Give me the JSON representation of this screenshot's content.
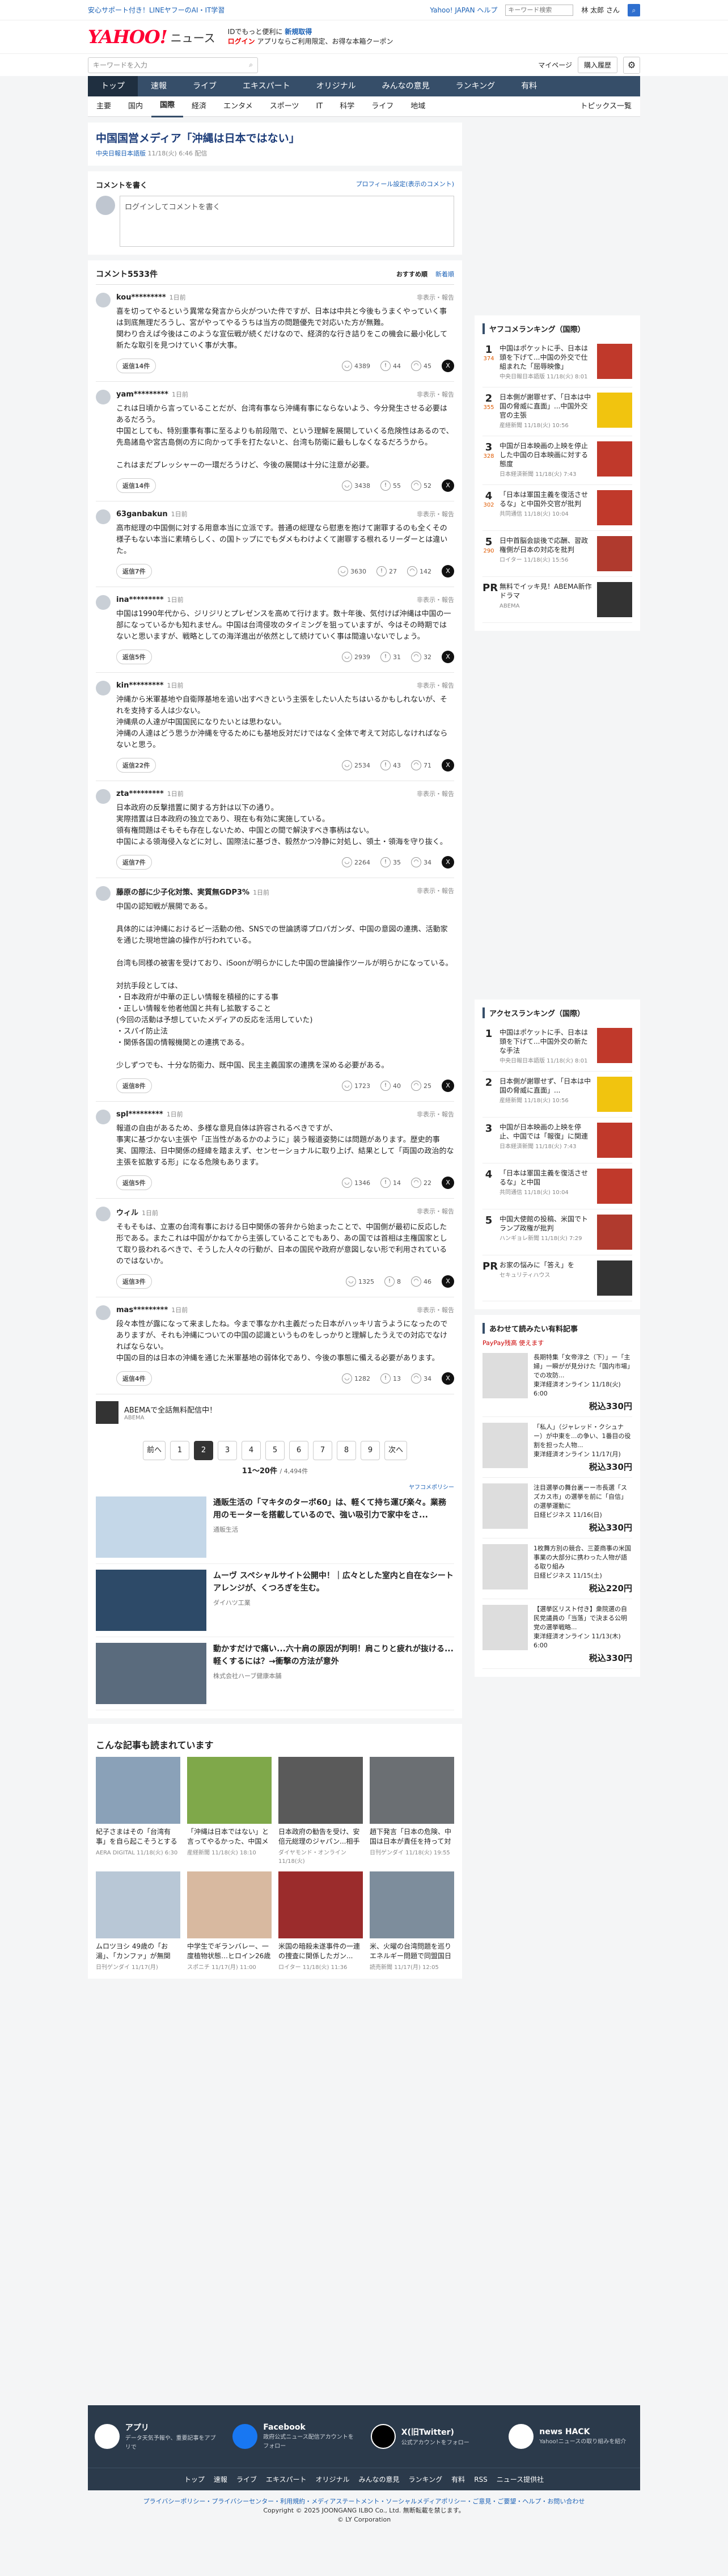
{
  "topbar": {
    "left": "安心サポート付き！LINEヤフーのAI・IT学習",
    "help": "Yahoo! JAPAN ヘルプ",
    "placeholder": "キーワード検索",
    "user": "林 太郎 さん"
  },
  "header": {
    "logo": "YAHOO!",
    "logo_sub": "JAPAN",
    "service": "ニュース",
    "promo1": "IDでもっと便利に",
    "promo1b": "新規取得",
    "promo2": "ログイン",
    "promo3": "アプリならご利用限定、お得な本箱クーポン"
  },
  "search": {
    "placeholder": "キーワードを入力",
    "mypage": "マイページ",
    "purchase": "購入履歴"
  },
  "gnav": [
    "トップ",
    "速報",
    "ライブ",
    "エキスパート",
    "オリジナル",
    "みんなの意見",
    "ランキング",
    "有料"
  ],
  "subnav": [
    "主要",
    "国内",
    "国際",
    "経済",
    "エンタメ",
    "スポーツ",
    "IT",
    "科学",
    "ライフ",
    "地域"
  ],
  "topics_list": "トピックス一覧",
  "article": {
    "title": "中国国営メディア「沖縄は日本ではない」",
    "source": "中央日報日本語版",
    "time": "11/18(火) 6:46",
    "sub": "配信"
  },
  "comment_form": {
    "title": "コメントを書く",
    "profile_link": "プロフィール設定(表示のコメント)",
    "placeholder": "ログインしてコメントを書く"
  },
  "comments_header": {
    "count": "コメント5533件",
    "sort_rec": "おすすめ順",
    "sort_new": "新着順"
  },
  "comments": [
    {
      "user": "kou*********",
      "time": "1日前",
      "report": "非表示・報告",
      "text": "喜を切ってやるという異常な発言から火がついた件ですが、日本は中共と今後もうまくやっていく事は到底無理だろうし、宮がやってやるうちは当方の問題優先で対応いた方が無難。\n関わり合えば今後はこのような宣伝戦が続くだけなので、経済的な行き詰りをこの機会に最小化して新たな取引を見つけていく事が大事。",
      "reply": "返信14件",
      "v1": "4389",
      "v2": "44",
      "v3": "45"
    },
    {
      "user": "yam*********",
      "time": "1日前",
      "report": "非表示・報告",
      "text": "これは日頃から言っていることだが、台湾有事なら沖縄有事にならないよう、今分発生させる必要はあるだろう。\n中国としても、特別重事有事に至るよりも前段階で、という理解を展開していくる危険性はあるので、先島諸島や宮古島側の方に向かって手を打たないと、台湾も防衛に最もしなくなるだろうから。\n\nこれはまだプレッシャーの一環だろうけど、今後の展開は十分に注意が必要。",
      "reply": "返信14件",
      "v1": "3438",
      "v2": "55",
      "v3": "52"
    },
    {
      "user": "63ganbakun",
      "time": "1日前",
      "report": "非表示・報告",
      "text": "高市総理の中国側に対する用意本当に立派です。普通の総理なら慰恵を抱けて謝罪するのも全くその様子もない本当に素晴らしく、の国トップにでもダメもわけよくて謝罪する根れるリーダーとは違いた。",
      "reply": "返信7件",
      "v1": "3630",
      "v2": "27",
      "v3": "142"
    },
    {
      "user": "ina*********",
      "time": "1日前",
      "report": "非表示・報告",
      "text": "中国は1990年代から、ジリジリとプレゼンスを高めて行けます。数十年後、気付けば沖縄は中国の一部になっているかも知れません。中国は台湾侵攻のタイミングを狙っていますが、今はその時期ではないと思いますが、戦略としての海洋進出が依然として続けていく事は間違いないでしょう。",
      "reply": "返信5件",
      "v1": "2939",
      "v2": "31",
      "v3": "32"
    },
    {
      "user": "kin*********",
      "time": "1日前",
      "report": "非表示・報告",
      "text": "沖縄から米軍基地や自衛隊基地を追い出すべきという主張をしたい人たちはいるかもしれないが、それを支持する人は少ない。\n沖縄県の人達が中国国民になりたいとは思わない。\n沖縄の人達はどう思うか沖縄を守るためにも基地反対だけではなく全体で考えて対応しなければならないと思う。",
      "reply": "返信22件",
      "v1": "2534",
      "v2": "43",
      "v3": "71"
    },
    {
      "user": "zta*********",
      "time": "1日前",
      "report": "非表示・報告",
      "text": "日本政府の反撃措置に関する方針は以下の通り。\n実際措置は日本政府の独立であり、現在も有効に実施している。\n領有権問題はそもそも存在しないため、中国との間で解決すべき事柄はない。\n中国による領海侵入などに対し、国際法に基づき、毅然かつ冷静に対処し、領土・領海を守り抜く。",
      "reply": "返信7件",
      "v1": "2264",
      "v2": "35",
      "v3": "34"
    },
    {
      "user": "藤原の部に少子化対策、実質無GDP3%",
      "time": "1日前",
      "report": "非表示・報告",
      "text": "中国の認知戦が展開である。\n\n具体的には沖縄におけるビー活動の他、SNSでの世論誘導プロパガンダ、中国の意図の連携、活動家を通じた現地世論の操作が行われている。\n\n台湾も同様の被害を受けており、iSoonが明らかにした中国の世論操作ツールが明らかになっている。\n\n対抗手段としては、\n・日本政府が中華の正しい情報を積極的にする事\n・正しい情報を他者他国と共有し拡散すること\n(今回の活動は予想していたメディアの反応を活用していた)\n・スパイ防止法\n・関係各国の情報機関との連携である。\n\n少しずつでも、十分な防衛力、既中国、民主主義国家の連携を深める必要がある。",
      "reply": "返信8件",
      "v1": "1723",
      "v2": "40",
      "v3": "25"
    },
    {
      "user": "spl*********",
      "time": "1日前",
      "report": "非表示・報告",
      "text": "報道の自由があるため、多様な意見自体は許容されるべきですが、\n事実に基づかない主張や「正当性があるかのように」装う報道姿勢には問題があります。歴史的事実、国際法、日中関係の経緯を踏まえず、センセーショナルに取り上げ、結果として「両国の政治的な主張を拡散する形」になる危険もあります。",
      "reply": "返信5件",
      "v1": "1346",
      "v2": "14",
      "v3": "22"
    },
    {
      "user": "ウィル",
      "time": "1日前",
      "report": "非表示・報告",
      "text": "そもそもは、立憲の台湾有事における日中関係の答弁から始まったことで、中国側が最初に反応した形である。またこれは中国がかねてから主張していることでもあり、あの国では首相は主権国家として取り扱われるべきで、そうした人々の行動が、日本の国民や政府が意図しない形で利用されているのではないか。",
      "reply": "返信3件",
      "v1": "1325",
      "v2": "8",
      "v3": "46"
    },
    {
      "user": "mas*********",
      "time": "1日前",
      "report": "非表示・報告",
      "text": "段々本性が露になって来ましたね。今まで事なかれ主義だった日本がハッキリ言うようになったのでありますが、それも沖縄についての中国の認識というものをしっかりと理解したうえでの対応でなければならない。\n中国の目的は日本の沖縄を通じた米軍基地の弱体化であり、今後の事態に備える必要があります。",
      "reply": "返信4件",
      "v1": "1282",
      "v2": "13",
      "v3": "34"
    }
  ],
  "ad_inline": {
    "text": "ABEMAで全話無料配信中！",
    "sub": "ABEMA"
  },
  "pager": {
    "prev": "前へ",
    "next": "次へ",
    "pages": [
      "1",
      "2",
      "3",
      "4",
      "5",
      "6",
      "7",
      "8",
      "9"
    ],
    "current": "2",
    "range": "11〜20件",
    "total": "/ 4,494件"
  },
  "yahoo_sponsor": "ヤフコメポリシー",
  "ads": [
    {
      "title": "通販生活の「マキタのターボ60」は、軽くて持ち運び楽々。業務用のモーターを搭載しているので、強い吸引力で家中をさ...",
      "src": "通販生活"
    },
    {
      "title": "ムーヴ スペシャルサイト公開中！｜広々とした室内と自在なシートアレンジが、くつろぎを生む。",
      "src": "ダイハツ工業"
    },
    {
      "title": "動かすだけで痛い...六十肩の原因が判明！肩こりと疲れが抜ける...軽くするには？→衝撃の方法が意外",
      "src": "株式会社ハーブ健康本舗"
    }
  ],
  "also_read": {
    "title": "こんな記事も読まれています",
    "items": [
      {
        "t": "紀子さまはその「台湾有事」を自ら起こそうとする高市首相",
        "s": "AERA DIGITAL 11/18(火) 6:30"
      },
      {
        "t": "「沖縄は日本ではない」と言ってやるかった、中国メディアの主張",
        "s": "産経新聞 11/18(火) 18:10"
      },
      {
        "t": "日本政府の勧告を受け、安倍元総理のジャパン...相手の実力を...",
        "s": "ダイヤモンド・オンライン 11/18(火)"
      },
      {
        "t": "趙下発言「日本の危険、中国は日本が責任を持って対処...",
        "s": "日刊ゲンダイ 11/18(火) 19:55"
      },
      {
        "t": "ムロツヨシ 49歳の「お湯」、「カンファ」が無関連...",
        "s": "日刊ゲンダイ 11/17(月)"
      },
      {
        "t": "中学生でギランバレー、一度植物状態…ヒロイン26歳の前向き...",
        "s": "スポニチ 11/17(月) 11:00"
      },
      {
        "t": "米国の暗殺未遂事件の一連の捜査に関係したガン...",
        "s": "ロイター 11/18(火) 11:36"
      },
      {
        "t": "米、火曜の台湾問題を巡りエネルギー問題で同盟国日本への働きかけ",
        "s": "読売新聞 11/17(月) 12:05"
      }
    ]
  },
  "ranking": {
    "title": "ヤフコメランキング（国際）",
    "items": [
      {
        "no": "1",
        "c": "374",
        "t": "中国はポケットに手、日本は頭を下げて...中国の外交で仕組まれた「屈辱映像」",
        "m": "中央日報日本語版 11/18(火) 8:01"
      },
      {
        "no": "2",
        "c": "355",
        "t": "日本側が謝罪せず、「日本は中国の脅威に直面」...中国外交官の主張",
        "m": "産経新聞 11/18(火) 10:56"
      },
      {
        "no": "3",
        "c": "328",
        "t": "中国が日本映画の上映を停止した中国の日本映画に対する態度",
        "m": "日本経済新聞 11/18(火) 7:43"
      },
      {
        "no": "4",
        "c": "302",
        "t": "「日本は軍国主義を復活させるな」と中国外交官が批判",
        "m": "共同通信 11/18(火) 10:04"
      },
      {
        "no": "5",
        "c": "290",
        "t": "日中首脳会談後で応酬、習政権側が日本の対応を批判",
        "m": "ロイター 11/18(火) 15:56"
      },
      {
        "no": "PR",
        "c": "",
        "t": "無料でイッキ見！ABEMA新作ドラマ",
        "m": "ABEMA"
      }
    ]
  },
  "access": {
    "title": "アクセスランキング（国際）",
    "items": [
      {
        "no": "1",
        "t": "中国はポケットに手、日本は頭を下げて...中国外交の新たな手法",
        "m": "中央日報日本語版 11/18(火) 8:01"
      },
      {
        "no": "2",
        "t": "日本側が謝罪せず、「日本は中国の脅威に直面」...",
        "m": "産経新聞 11/18(火) 10:56"
      },
      {
        "no": "3",
        "t": "中国が日本映画の上映を停止、中国では「報復」に関連",
        "m": "日本経済新聞 11/18(火) 7:43"
      },
      {
        "no": "4",
        "t": "「日本は軍国主義を復活させるな」と中国",
        "m": "共同通信 11/18(火) 10:04"
      },
      {
        "no": "5",
        "t": "中国大使館の投稿、米国でトランプ政権が批判",
        "m": "ハンギョレ新聞 11/18(火) 7:29"
      },
      {
        "no": "PR",
        "t": "お家の悩みに「答え」を",
        "m": "セキュリティハウス"
      }
    ]
  },
  "shopping": {
    "title": "あわせて読みたい有料記事",
    "sub": "PayPay残高 使えます",
    "items": [
      {
        "t": "長期特集「女帝淳之（下）」ー「主婦」一瞬がが見分けた「国内市場」での攻防...",
        "m": "東洋経済オンライン 11/18(火) 6:00",
        "p": "税込330円"
      },
      {
        "t": "「私人」（ジャレッド・クシュナー）が中東を...の争い、1番目の役割を担った人物...",
        "m": "東洋経済オンライン 11/17(月)",
        "p": "税込330円"
      },
      {
        "t": "注目選挙の舞台裏ーー市長選「スズカス市」の選挙を前に「自信」の選挙運動に",
        "m": "日経ビジネス 11/16(日)",
        "p": "税込330円"
      },
      {
        "t": "1枚舞方別の競合、三菱商事の米国事業の大部分に携わった人物が語る取り組み",
        "m": "日経ビジネス 11/15(土)",
        "p": "税込220円"
      },
      {
        "t": "【選挙区リスト付き】衆院選の自民党議員の「当落」で決まる公明党の選挙戦略...",
        "m": "東洋経済オンライン 11/13(木) 6:00",
        "p": "税込330円"
      }
    ]
  },
  "footer": {
    "apps": [
      {
        "n": "アプリ",
        "s": "データ天気予報や、重要記事をアプリで"
      },
      {
        "n": "Facebook",
        "s": "政府公式ニュース配信アカウントをフォロー"
      },
      {
        "n": "X(旧Twitter)",
        "s": "公式アカウントをフォロー"
      },
      {
        "n": "news HACK",
        "s": "Yahoo!ニュースの取り組みを紹介"
      }
    ],
    "links": [
      "トップ",
      "速報",
      "ライブ",
      "エキスパート",
      "オリジナル",
      "みんなの意見",
      "ランキング",
      "有料",
      "RSS",
      "ニュース提供社"
    ],
    "policy": "プライバシーポリシー・プライバシーセンター・利用規約・メディアステートメント・ソーシャルメディアポリシー・ご意見・ご要望・ヘルプ・お問い合わせ",
    "copy1": "Copyright © 2025 JOONGANG ILBO Co., Ltd. 無断転載を禁じます。",
    "copy2": "© LY Corporation"
  }
}
